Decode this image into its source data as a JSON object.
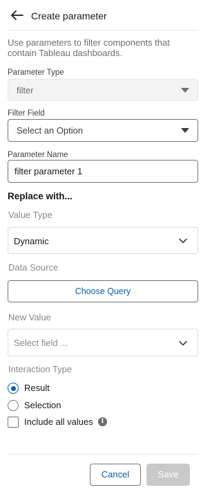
{
  "header": {
    "title": "Create parameter"
  },
  "description": "Use parameters to filter components that contain Tableau dashboards.",
  "parameter_type": {
    "label": "Parameter Type",
    "value": "filter"
  },
  "filter_field": {
    "label": "Filter Field",
    "placeholder": "Select an Option"
  },
  "parameter_name": {
    "label": "Parameter Name",
    "value": "filter parameter 1"
  },
  "replace_with": {
    "title": "Replace with..."
  },
  "value_type": {
    "label": "Value Type",
    "value": "Dynamic"
  },
  "data_source": {
    "label": "Data Source",
    "button_label": "Choose Query"
  },
  "new_value": {
    "label": "New Value",
    "placeholder": "Select field ..."
  },
  "interaction_type": {
    "label": "Interaction Type",
    "options": [
      {
        "label": "Result",
        "selected": true
      },
      {
        "label": "Selection",
        "selected": false
      }
    ],
    "include_all": {
      "label": "Include all values",
      "checked": false
    }
  },
  "footer": {
    "cancel_label": "Cancel",
    "save_label": "Save"
  },
  "colors": {
    "brand": "#0b5cab",
    "disabled": "#c9c9c9",
    "muted_text": "#706e6b"
  }
}
